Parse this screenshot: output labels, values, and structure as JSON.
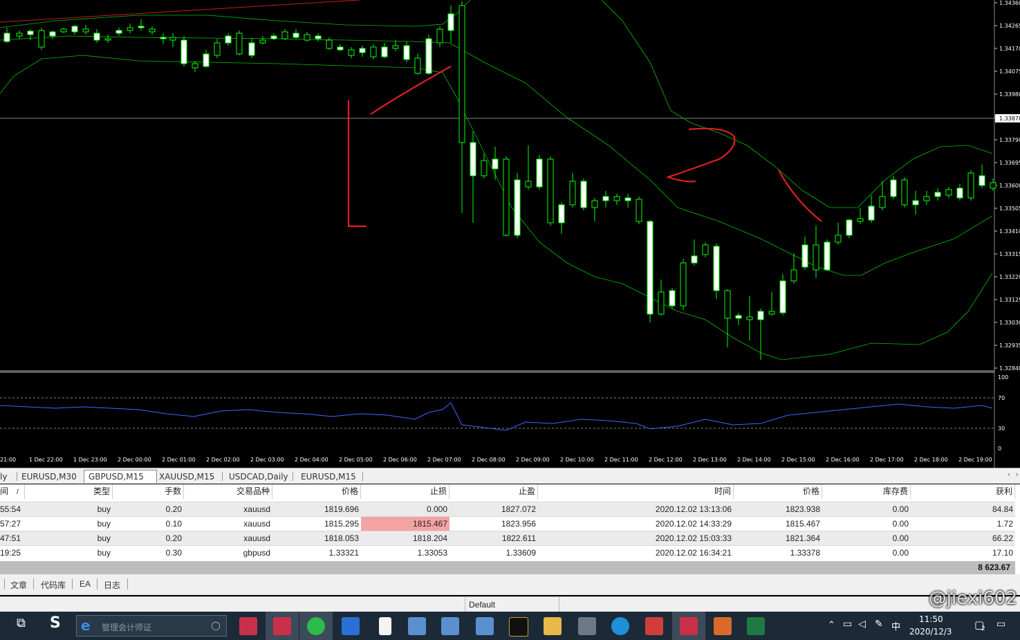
{
  "chart": {
    "symbol": "GBPUSD,M15",
    "price_labels": [
      "1.34360",
      "1.34265",
      "1.34170",
      "1.34075",
      "1.33980",
      "1.33875",
      "1.33790",
      "1.33695",
      "1.33600",
      "1.33505",
      "1.33410",
      "1.33315",
      "1.33220",
      "1.33125",
      "1.33030",
      "1.32935",
      "1.32840"
    ],
    "current_price": "1.33878",
    "rsi_labels": [
      "100",
      "70",
      "30",
      "0"
    ],
    "time_labels": [
      "21:00",
      "1 Dec 22:00",
      "1 Dec 23:00",
      "2 Dec 00:00",
      "2 Dec 01:00",
      "2 Dec 02:00",
      "2 Dec 03:00",
      "2 Dec 04:00",
      "2 Dec 05:00",
      "2 Dec 06:00",
      "2 Dec 07:00",
      "2 Dec 08:00",
      "2 Dec 09:00",
      "2 Dec 10:00",
      "2 Dec 11:00",
      "2 Dec 12:00",
      "2 Dec 13:00",
      "2 Dec 14:00",
      "2 Dec 15:00",
      "2 Dec 16:00",
      "2 Dec 17:00",
      "2 Dec 18:00",
      "2 Dec 19:00"
    ],
    "colors": {
      "background": "#000000",
      "bull": "#ffffff",
      "bear": "#000000",
      "wick": "#00ff00",
      "band": "#00c000",
      "rsi": "#4466ff",
      "annotation": "#e02020"
    },
    "annotation_marks": [
      "1",
      "2"
    ]
  },
  "symbol_tabs": [
    "ly",
    "EURUSD,M30",
    "GBPUSD,M15",
    "XAUUSD,M15",
    "USDCAD,Daily",
    "EURUSD,M15"
  ],
  "active_tab": "GBPUSD,M15",
  "table": {
    "headers": [
      "间",
      "类型",
      "手数",
      "交易品种",
      "价格",
      "止损",
      "止盈",
      "时间",
      "价格",
      "库存费",
      "获利"
    ],
    "sort_marker": "/",
    "rows": [
      [
        "55:54",
        "buy",
        "0.20",
        "xauusd",
        "1819.696",
        "0.000",
        "1827.072",
        "2020.12.02 13:13:06",
        "1823.938",
        "0.00",
        "84.84"
      ],
      [
        "57:27",
        "buy",
        "0.10",
        "xauusd",
        "1815.295",
        "1815.467",
        "1823.956",
        "2020.12.02 14:33:29",
        "1815.467",
        "0.00",
        "1.72"
      ],
      [
        "47:51",
        "buy",
        "0.20",
        "xauusd",
        "1818.053",
        "1818.204",
        "1822.611",
        "2020.12.02 15:03:33",
        "1821.364",
        "0.00",
        "66.22"
      ],
      [
        "19:25",
        "buy",
        "0.30",
        "gbpusd",
        "1.33321",
        "1.33053",
        "1.33609",
        "2020.12.02 16:34:21",
        "1.33378",
        "0.00",
        "17.10"
      ]
    ],
    "total": "8 623.67"
  },
  "bottom_tabs": [
    "文章",
    "代码库",
    "EA",
    "日志"
  ],
  "status": {
    "profile": "Default"
  },
  "taskbar": {
    "search_placeholder": "管理会计师证",
    "time": "11:50",
    "date": "2020/12/3",
    "ime": "中",
    "notification_count": "2",
    "watermark": "@jiexi602"
  }
}
